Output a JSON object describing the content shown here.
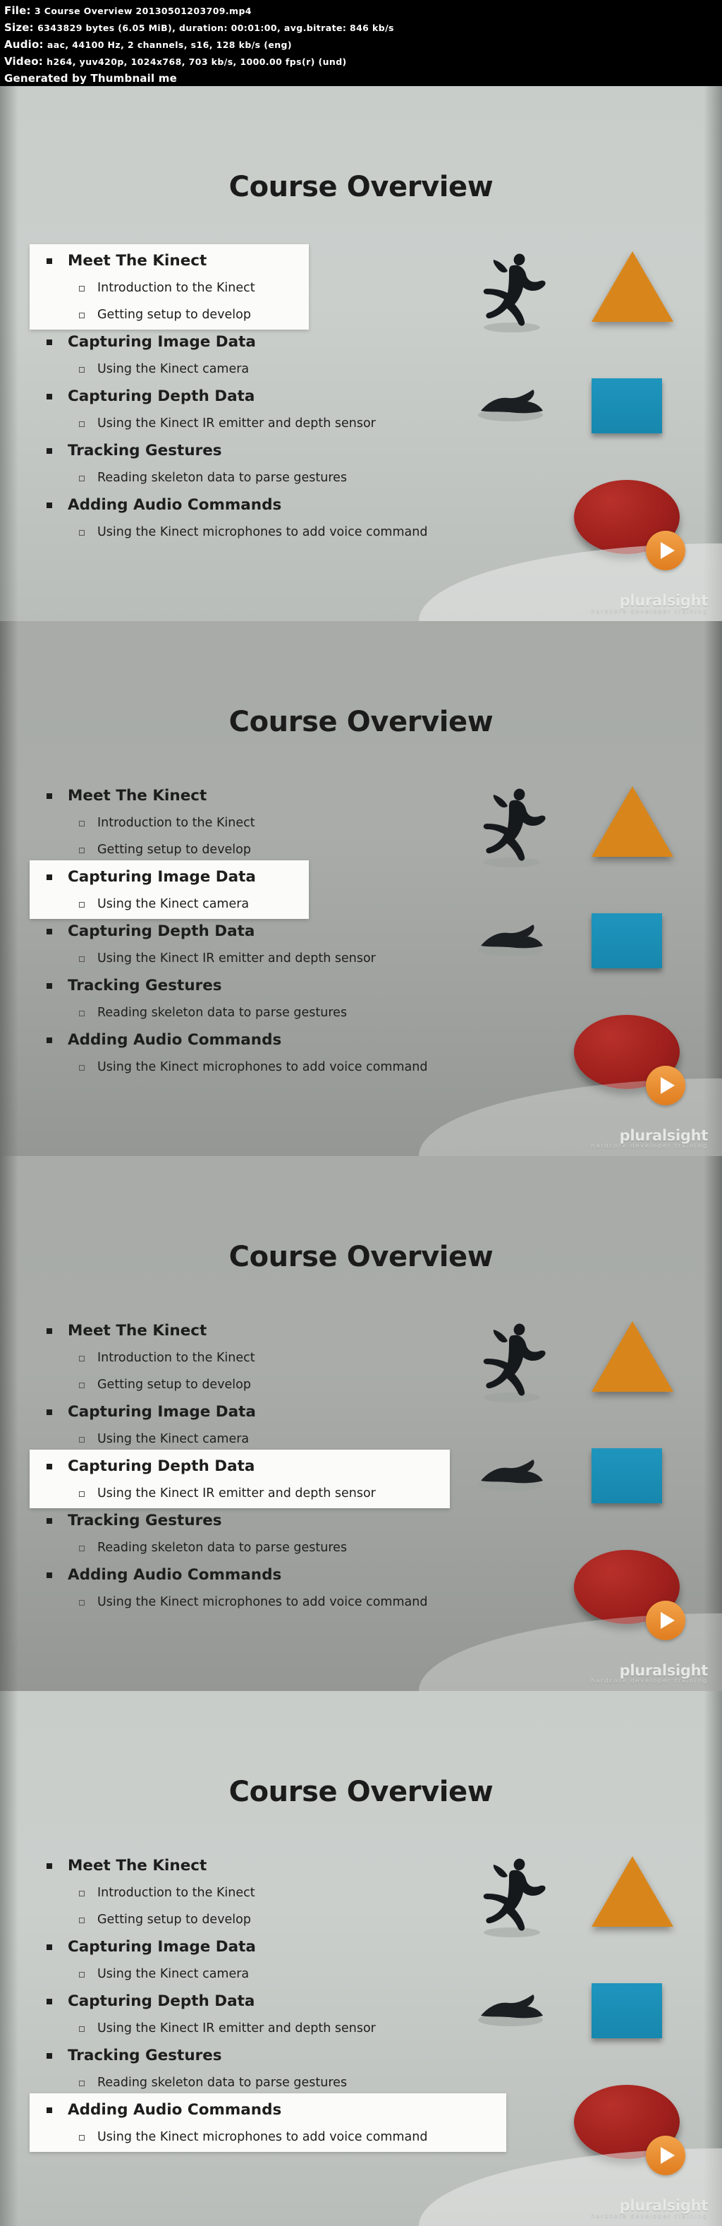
{
  "meta": {
    "file_label": "File:",
    "file_value": "3 Course Overview 20130501203709.mp4",
    "size_label": "Size:",
    "size_value": "6343829 bytes (6.05 MiB), duration: 00:01:00, avg.bitrate: 846 kb/s",
    "audio_label": "Audio:",
    "audio_value": "aac, 44100 Hz, 2 channels, s16, 128 kb/s (eng)",
    "video_label": "Video:",
    "video_value": "h264, yuv420p, 1024x768, 703 kb/s, 1000.00 fps(r) (und)",
    "generator": "Generated by Thumbnail me"
  },
  "slide": {
    "title": "Course Overview",
    "groups": [
      {
        "heading": "Meet The Kinect",
        "subs": [
          "Introduction to the Kinect",
          "Getting setup to develop"
        ]
      },
      {
        "heading": "Capturing Image Data",
        "subs": [
          "Using the Kinect camera"
        ]
      },
      {
        "heading": "Capturing Depth Data",
        "subs": [
          "Using the Kinect IR emitter and depth sensor"
        ]
      },
      {
        "heading": "Tracking Gestures",
        "subs": [
          "Reading skeleton data to parse gestures"
        ]
      },
      {
        "heading": "Adding Audio Commands",
        "subs": [
          "Using the Kinect microphones to add voice command"
        ]
      }
    ],
    "watermark": "pluralsight",
    "watermark_sub": "hardcore developer training",
    "colors": {
      "triangle": "#d8861c",
      "square": "#1f95bd",
      "ellipse": "#a3201c",
      "play_button": "#e07d1f"
    }
  },
  "frames": [
    {
      "index": 1,
      "active_group": 0,
      "dim": false,
      "highlight_width": "narrow"
    },
    {
      "index": 2,
      "active_group": 1,
      "dim": true,
      "highlight_width": "narrow"
    },
    {
      "index": 3,
      "active_group": 2,
      "dim": true,
      "highlight_width": "wide"
    },
    {
      "index": 4,
      "active_group": 4,
      "dim": false,
      "highlight_width": "wide2"
    }
  ]
}
